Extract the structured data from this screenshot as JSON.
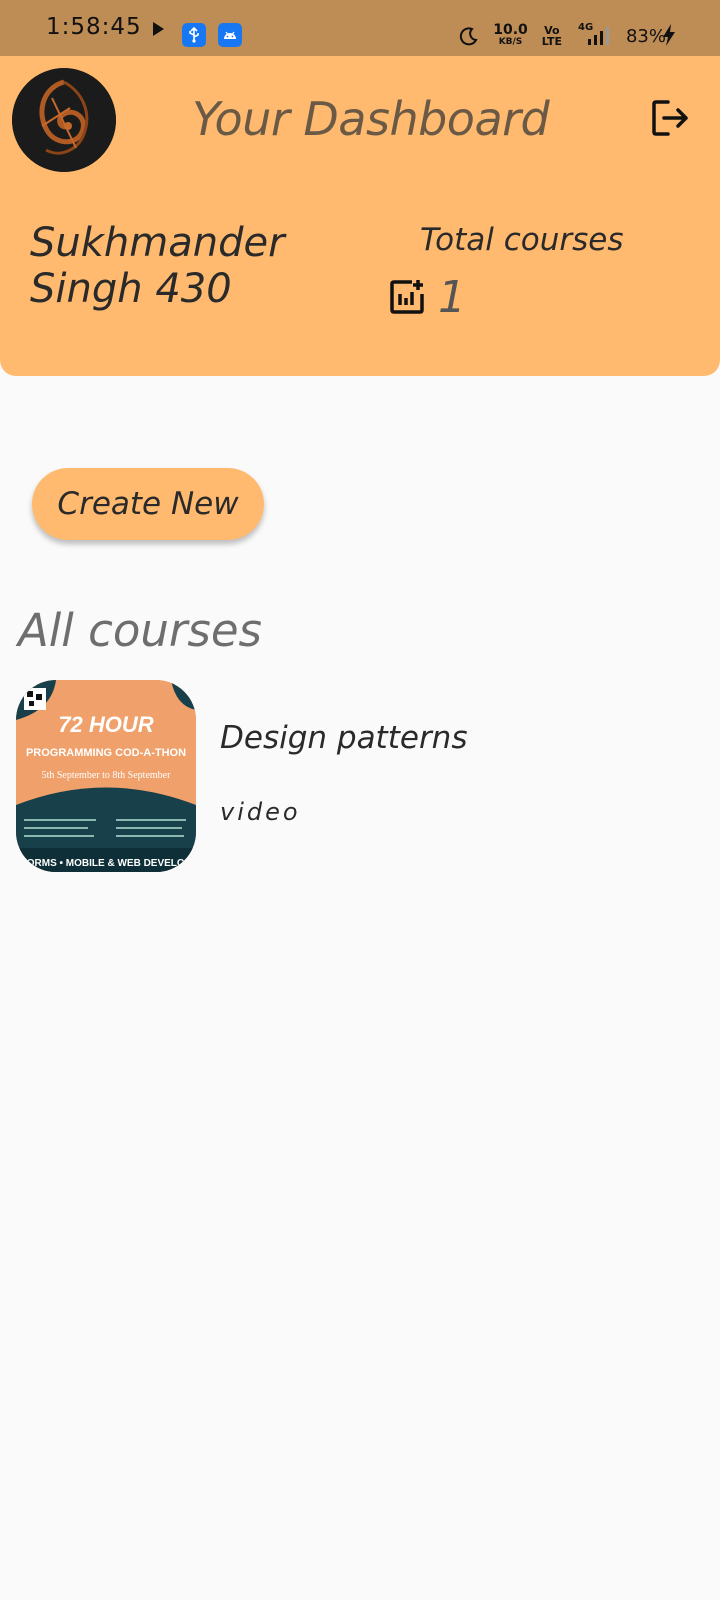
{
  "status_bar": {
    "time": "1:58:45",
    "net_speed": "10.0",
    "net_unit": "KB/S",
    "volte_top": "Vo",
    "volte_bottom": "LTE",
    "network": "4G",
    "battery": "83%"
  },
  "header": {
    "title": "Your Dashboard",
    "user_name": "Sukhmander Singh 430",
    "total_label": "Total courses",
    "total_count": "1"
  },
  "actions": {
    "create_label": "Create New"
  },
  "courses": {
    "section_title": "All courses",
    "items": [
      {
        "name": "Design patterns",
        "type": "video",
        "thumb_lines": [
          "72 HOUR",
          "PROGRAMMING COD-A-THON",
          "5th September to 8th September",
          "FORMS • MOBILE & WEB DEVELOP"
        ]
      }
    ]
  },
  "colors": {
    "status_bar": "#be8c55",
    "header": "#ffba70",
    "background": "#fafafa"
  }
}
